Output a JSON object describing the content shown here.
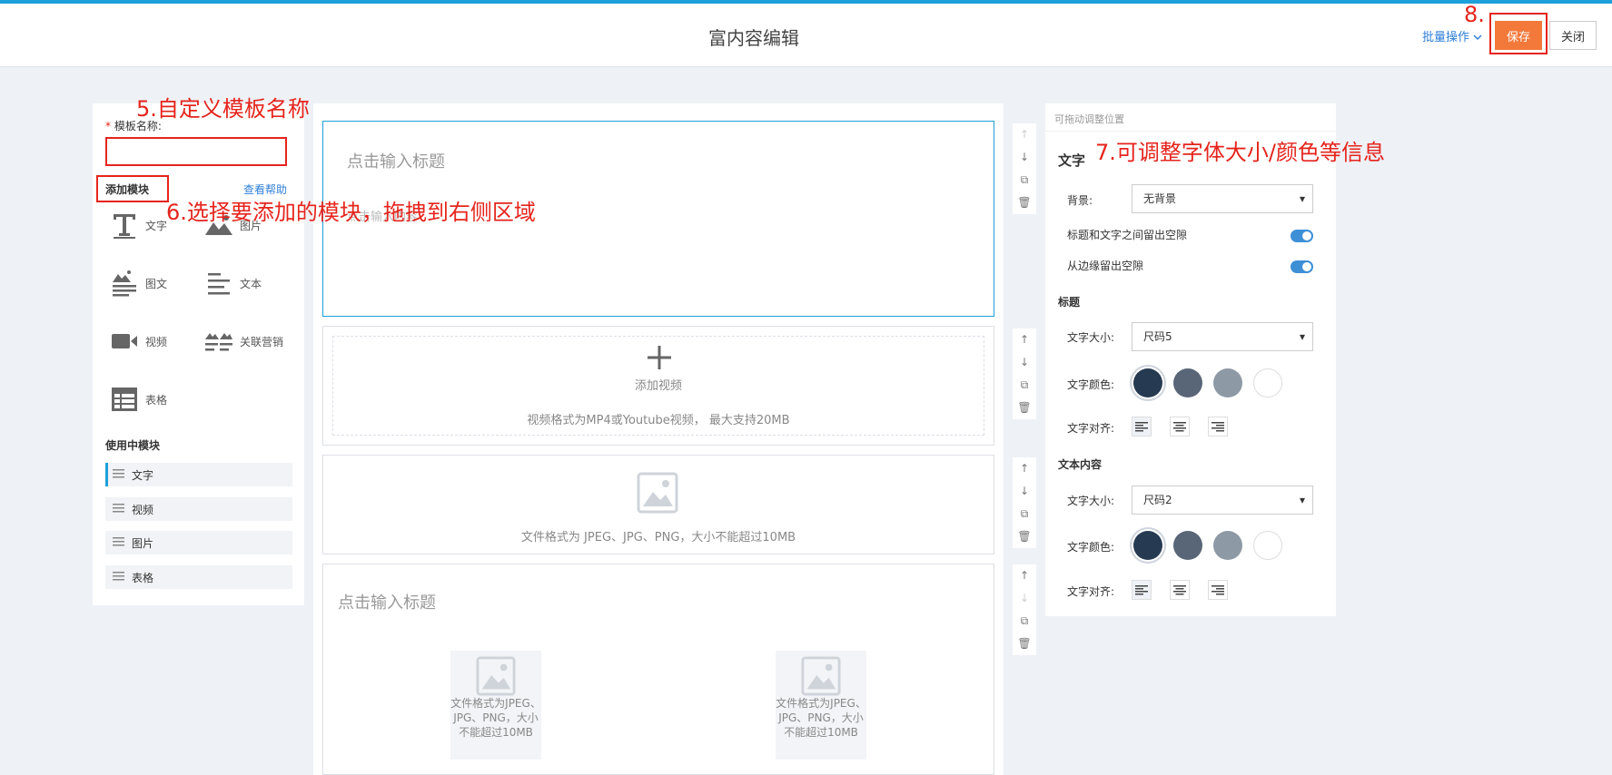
{
  "header": {
    "title": "富内容编辑",
    "batch_label": "批量操作",
    "save_label": "保存",
    "close_label": "关闭"
  },
  "annotations": {
    "a5": "5.自定义模板名称",
    "a6": "6.选择要添加的模块，拖拽到右侧区域",
    "a7": "7.可调整字体大小/颜色等信息",
    "a8": "8."
  },
  "left_panel": {
    "template_name_label": "模板名称:",
    "required_mark": "*",
    "template_name_value": "",
    "add_module_label": "添加模块",
    "help_link": "查看帮助",
    "modules": [
      {
        "label": "文字",
        "icon": "text-icon"
      },
      {
        "label": "图片",
        "icon": "image-icon"
      },
      {
        "label": "图文",
        "icon": "image-text-icon"
      },
      {
        "label": "文本",
        "icon": "paragraph-icon"
      },
      {
        "label": "视频",
        "icon": "video-icon"
      },
      {
        "label": "关联营销",
        "icon": "related-marketing-icon"
      },
      {
        "label": "表格",
        "icon": "table-icon"
      }
    ],
    "in_use_title": "使用中模块",
    "in_use": [
      {
        "label": "文字"
      },
      {
        "label": "视频"
      },
      {
        "label": "图片"
      },
      {
        "label": "表格"
      }
    ]
  },
  "canvas": {
    "text_block": {
      "title_placeholder": "点击输入标题",
      "text_placeholder": "点击输入内容"
    },
    "video_block": {
      "add_label": "添加视频",
      "hint": "视频格式为MP4或Youtube视频， 最大支持20MB"
    },
    "image_block": {
      "hint": "文件格式为 JPEG、JPG、PNG，大小不能超过10MB"
    },
    "table_block": {
      "title_placeholder": "点击输入标题",
      "cells": [
        {
          "caption": "文件格式为JPEG、JPG、PNG，大小不能超过10MB"
        },
        {
          "caption": "文件格式为JPEG、JPG、PNG，大小不能超过10MB"
        }
      ]
    }
  },
  "right_panel": {
    "drag_hint": "可拖动调整位置",
    "section_title": "文字",
    "background_label": "背景:",
    "background_value": "无背景",
    "gap_title_text_label": "标题和文字之间留出空隙",
    "gap_edge_label": "从边缘留出空隙",
    "heading_section": "标题",
    "text_size_label": "文字大小:",
    "heading_size_value": "尺码5",
    "text_color_label": "文字颜色:",
    "text_align_label": "文字对齐:",
    "content_section": "文本内容",
    "content_size_value": "尺码2",
    "colors": [
      "#263a52",
      "#596678",
      "#8e99a6",
      "#ffffff"
    ]
  }
}
